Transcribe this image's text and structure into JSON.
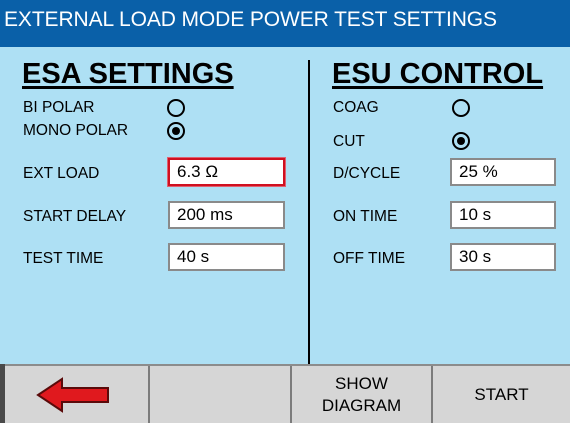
{
  "title": "EXTERNAL LOAD MODE POWER TEST SETTINGS",
  "esa": {
    "heading": "ESA SETTINGS",
    "polarity": [
      {
        "label": "BI POLAR",
        "selected": false
      },
      {
        "label": "MONO POLAR",
        "selected": true
      }
    ],
    "fields": [
      {
        "label": "EXT LOAD",
        "value": "6.3 Ω",
        "selected": true
      },
      {
        "label": "START DELAY",
        "value": "200 ms",
        "selected": false
      },
      {
        "label": "TEST TIME",
        "value": "40 s",
        "selected": false
      }
    ]
  },
  "esu": {
    "heading": "ESU CONTROL",
    "mode": [
      {
        "label": "COAG",
        "selected": false
      },
      {
        "label": "CUT",
        "selected": true
      }
    ],
    "fields": [
      {
        "label": "D/CYCLE",
        "value": "25 %"
      },
      {
        "label": "ON TIME",
        "value": "10 s"
      },
      {
        "label": "OFF TIME",
        "value": "30 s"
      }
    ]
  },
  "buttons": {
    "back_icon": "left-arrow-icon",
    "show_diagram_line1": "SHOW",
    "show_diagram_line2": "DIAGRAM",
    "start": "START"
  },
  "colors": {
    "title_bar": "#0a60a8",
    "panel": "#aee0f4",
    "selected_field_border": "#d01020",
    "back_arrow": "#e0191e"
  }
}
